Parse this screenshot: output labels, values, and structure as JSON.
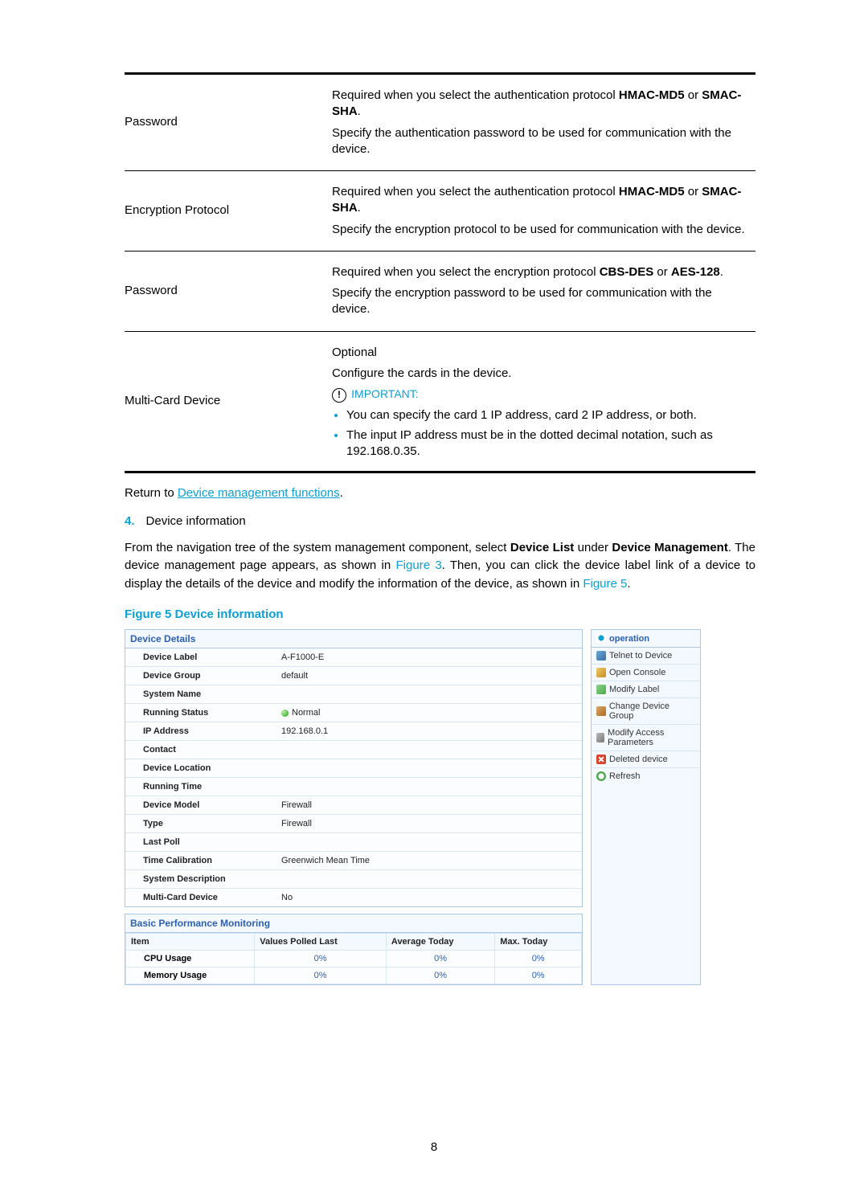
{
  "page_number": "8",
  "param_rows": [
    {
      "label": "Password",
      "lines": [
        {
          "html": "Required when you select the authentication protocol <b>HMAC-MD5</b> or <b>SMAC-SHA</b>."
        },
        {
          "html": "Specify the authentication password to be used for communication with the device."
        }
      ]
    },
    {
      "label": "Encryption Protocol",
      "lines": [
        {
          "html": "Required when you select the authentication protocol <b>HMAC-MD5</b> or <b>SMAC-SHA</b>."
        },
        {
          "html": "Specify the encryption protocol to be used for communication with the device."
        }
      ]
    },
    {
      "label": "Password",
      "lines": [
        {
          "html": "Required when you select the encryption protocol <b>CBS-DES</b> or <b>AES-128</b>."
        },
        {
          "html": "Specify the encryption password to be used for communication with the device."
        }
      ]
    },
    {
      "label": "Multi-Card Device",
      "lines": [
        {
          "html": "Optional"
        },
        {
          "html": "Configure the cards in the device."
        }
      ],
      "important_label": "IMPORTANT:",
      "bullets": [
        "You can specify the card 1 IP address, card 2 IP address, or both.",
        "The input IP address must be in the dotted decimal notation, such as 192.168.0.35."
      ]
    }
  ],
  "return_prefix": "Return to ",
  "return_link": "Device management functions",
  "return_suffix": ".",
  "step_num": "4.",
  "step_text": "Device information",
  "paragraph_html": "From the navigation tree of the system management component, select <b>Device List</b> under <b>Device Management</b>. The device management page appears, as shown in <span class='link'>Figure 3</span>. Then, you can click the device label link of a device to display the details of the device and modify the information of the device, as shown in <span class='link'>Figure 5</span>.",
  "figure_caption": "Figure 5 Device information",
  "device_details_header": "Device Details",
  "details": [
    {
      "label": "Device Label",
      "value": "A-F1000-E"
    },
    {
      "label": "Device Group",
      "value": "default"
    },
    {
      "label": "System Name",
      "value": ""
    },
    {
      "label": "Running Status",
      "value": "Normal",
      "status": true
    },
    {
      "label": "IP Address",
      "value": "192.168.0.1"
    },
    {
      "label": "Contact",
      "value": ""
    },
    {
      "label": "Device Location",
      "value": ""
    },
    {
      "label": "Running Time",
      "value": ""
    },
    {
      "label": "Device Model",
      "value": "Firewall"
    },
    {
      "label": "Type",
      "value": "Firewall"
    },
    {
      "label": "Last Poll",
      "value": ""
    },
    {
      "label": "Time Calibration",
      "value": "Greenwich Mean Time"
    },
    {
      "label": "System Description",
      "value": ""
    },
    {
      "label": "Multi-Card Device",
      "value": "No"
    }
  ],
  "perf_header": "Basic Performance Monitoring",
  "perf_cols": [
    "Item",
    "Values Polled Last",
    "Average Today",
    "Max. Today"
  ],
  "perf_rows": [
    {
      "label": "CPU Usage",
      "v": [
        "0%",
        "0%",
        "0%"
      ]
    },
    {
      "label": "Memory Usage",
      "v": [
        "0%",
        "0%",
        "0%"
      ]
    }
  ],
  "op_header": "operation",
  "op_items": [
    {
      "icon": "ic-telnet",
      "label": "Telnet to Device"
    },
    {
      "icon": "ic-console",
      "label": "Open Console"
    },
    {
      "icon": "ic-label",
      "label": "Modify Label"
    },
    {
      "icon": "ic-group",
      "label": "Change Device Group"
    },
    {
      "icon": "ic-access",
      "label": "Modify Access Parameters"
    },
    {
      "icon": "ic-delete",
      "label": "Deleted device"
    },
    {
      "icon": "ic-refresh",
      "label": "Refresh"
    }
  ]
}
